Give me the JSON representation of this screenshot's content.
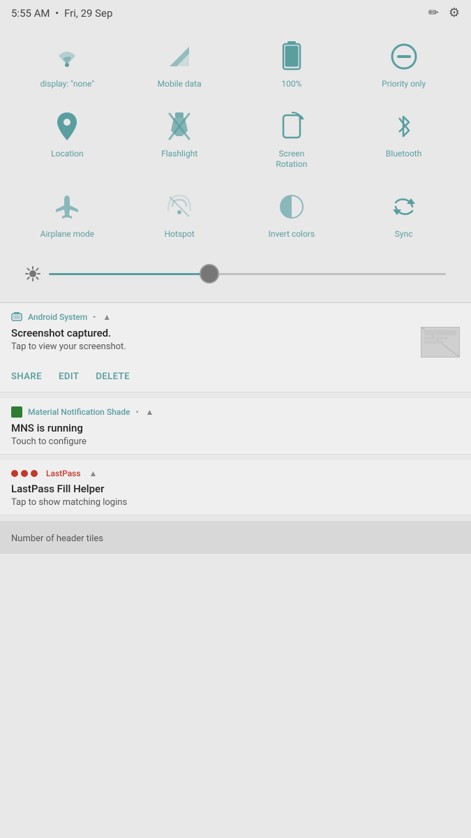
{
  "statusBar": {
    "time": "5:55 AM",
    "separator": "•",
    "date": "Fri, 29 Sep"
  },
  "quickSettings": {
    "rows": [
      [
        {
          "id": "wifi",
          "label": "display: \"none\"",
          "icon": "wifi"
        },
        {
          "id": "mobile-data",
          "label": "Mobile data",
          "icon": "signal"
        },
        {
          "id": "battery",
          "label": "100%",
          "icon": "battery"
        },
        {
          "id": "priority",
          "label": "Priority only",
          "icon": "minus-circle"
        }
      ],
      [
        {
          "id": "location",
          "label": "Location",
          "icon": "location"
        },
        {
          "id": "flashlight",
          "label": "Flashlight",
          "icon": "flashlight"
        },
        {
          "id": "screen-rotation",
          "label": "Screen Rotation",
          "icon": "rotation"
        },
        {
          "id": "bluetooth",
          "label": "Bluetooth",
          "icon": "bluetooth"
        }
      ],
      [
        {
          "id": "airplane",
          "label": "Airplane mode",
          "icon": "airplane"
        },
        {
          "id": "hotspot",
          "label": "Hotspot",
          "icon": "hotspot"
        },
        {
          "id": "invert",
          "label": "Invert colors",
          "icon": "invert"
        },
        {
          "id": "sync",
          "label": "Sync",
          "icon": "sync"
        }
      ]
    ]
  },
  "brightness": {
    "value": 40
  },
  "notifications": [
    {
      "id": "android-system",
      "appIcon": "image",
      "appName": "Android System",
      "dot": "•",
      "expandIcon": "▲",
      "title": "Screenshot captured.",
      "subtitle": "Tap to view your screenshot.",
      "hasThumbnail": true,
      "actions": [
        "SHARE",
        "EDIT",
        "DELETE"
      ]
    },
    {
      "id": "mns",
      "appIcon": "green-square",
      "appName": "Material Notification Shade",
      "dot": "•",
      "expandIcon": "▲",
      "title": "MNS is running",
      "subtitle": "Touch to configure",
      "hasThumbnail": false,
      "actions": []
    },
    {
      "id": "lastpass",
      "appIcon": "lastpass-dots",
      "appName": "LastPass",
      "dot": "",
      "expandIcon": "▲",
      "title": "LastPass Fill Helper",
      "subtitle": "Tap to show matching logins",
      "hasThumbnail": false,
      "actions": []
    }
  ],
  "bottomCard": {
    "text": "Number of header tiles"
  },
  "icons": {
    "pencil": "✏",
    "gear": "⚙"
  }
}
